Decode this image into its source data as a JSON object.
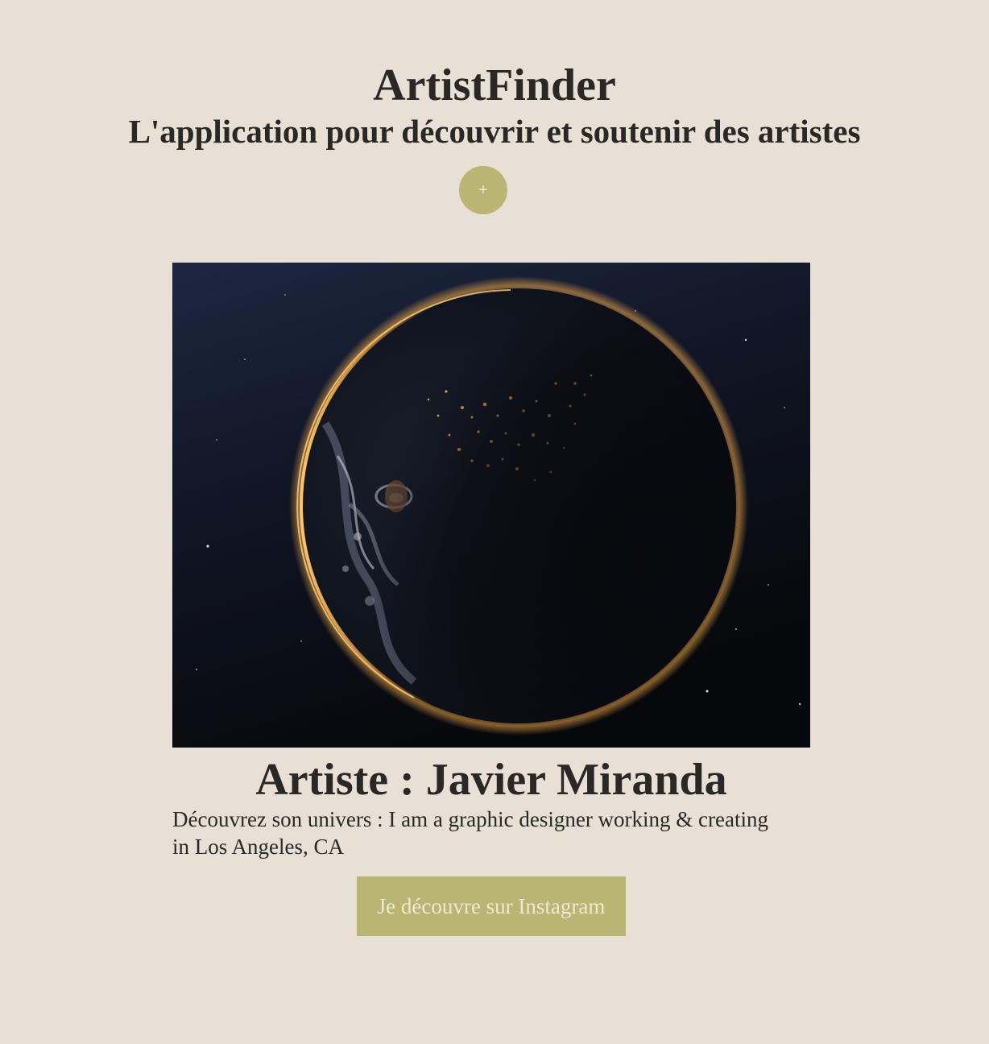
{
  "header": {
    "title": "ArtistFinder",
    "subtitle": "L'application pour découvrir et soutenir des artistes",
    "add_button_label": "+"
  },
  "artist": {
    "image_icon": "planet-artwork",
    "name_line": "Artiste : Javier Miranda",
    "bio_line_1": "Découvrez son univers : I am a graphic designer working & creating",
    "bio_line_2": "in Los Angeles, CA",
    "instagram_button_label": "Je découvre sur Instagram"
  },
  "colors": {
    "background": "#e8e0d5",
    "accent": "#bab572",
    "text": "#2a2826"
  }
}
